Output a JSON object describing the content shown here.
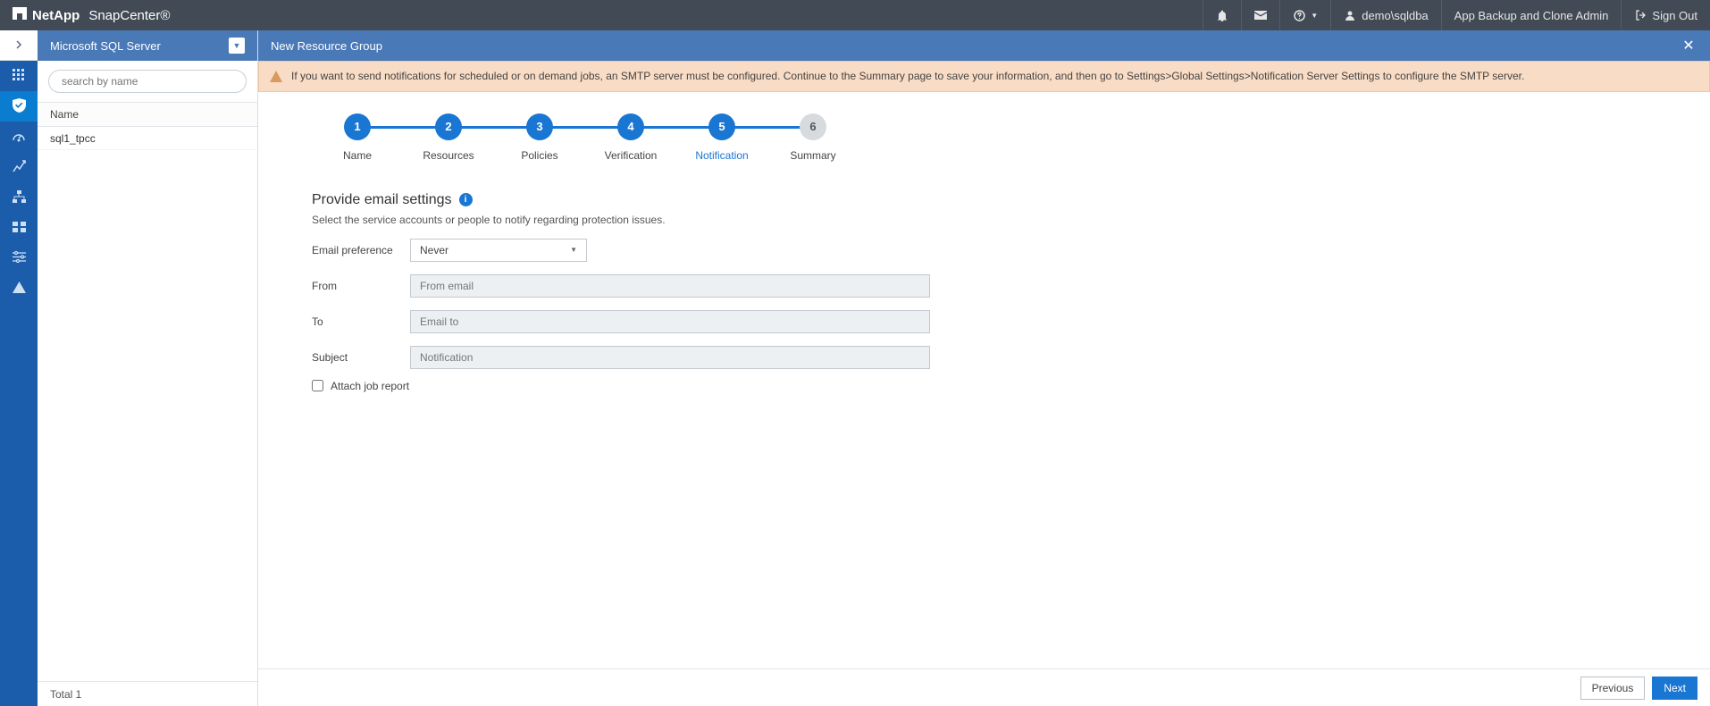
{
  "brand": {
    "company": "NetApp",
    "product": "SnapCenter®"
  },
  "topbar": {
    "user": "demo\\sqldba",
    "role": "App Backup and Clone Admin",
    "signout": "Sign Out"
  },
  "sidepanel": {
    "title": "Microsoft SQL Server",
    "search_placeholder": "search by name",
    "column": "Name",
    "items": [
      "sql1_tpcc"
    ],
    "footer": "Total 1"
  },
  "main": {
    "title": "New Resource Group",
    "alert": "If you want to send notifications for scheduled or on demand jobs, an SMTP server must be configured. Continue to the Summary page to save your information, and then go to Settings>Global Settings>Notification Server Settings to configure the SMTP server."
  },
  "steps": [
    {
      "n": "1",
      "label": "Name"
    },
    {
      "n": "2",
      "label": "Resources"
    },
    {
      "n": "3",
      "label": "Policies"
    },
    {
      "n": "4",
      "label": "Verification"
    },
    {
      "n": "5",
      "label": "Notification"
    },
    {
      "n": "6",
      "label": "Summary"
    }
  ],
  "form": {
    "heading": "Provide email settings",
    "sub": "Select the service accounts or people to notify regarding protection issues.",
    "pref_label": "Email preference",
    "pref_value": "Never",
    "from_label": "From",
    "from_placeholder": "From email",
    "to_label": "To",
    "to_placeholder": "Email to",
    "subject_label": "Subject",
    "subject_placeholder": "Notification",
    "attach_label": "Attach job report"
  },
  "buttons": {
    "prev": "Previous",
    "next": "Next"
  }
}
